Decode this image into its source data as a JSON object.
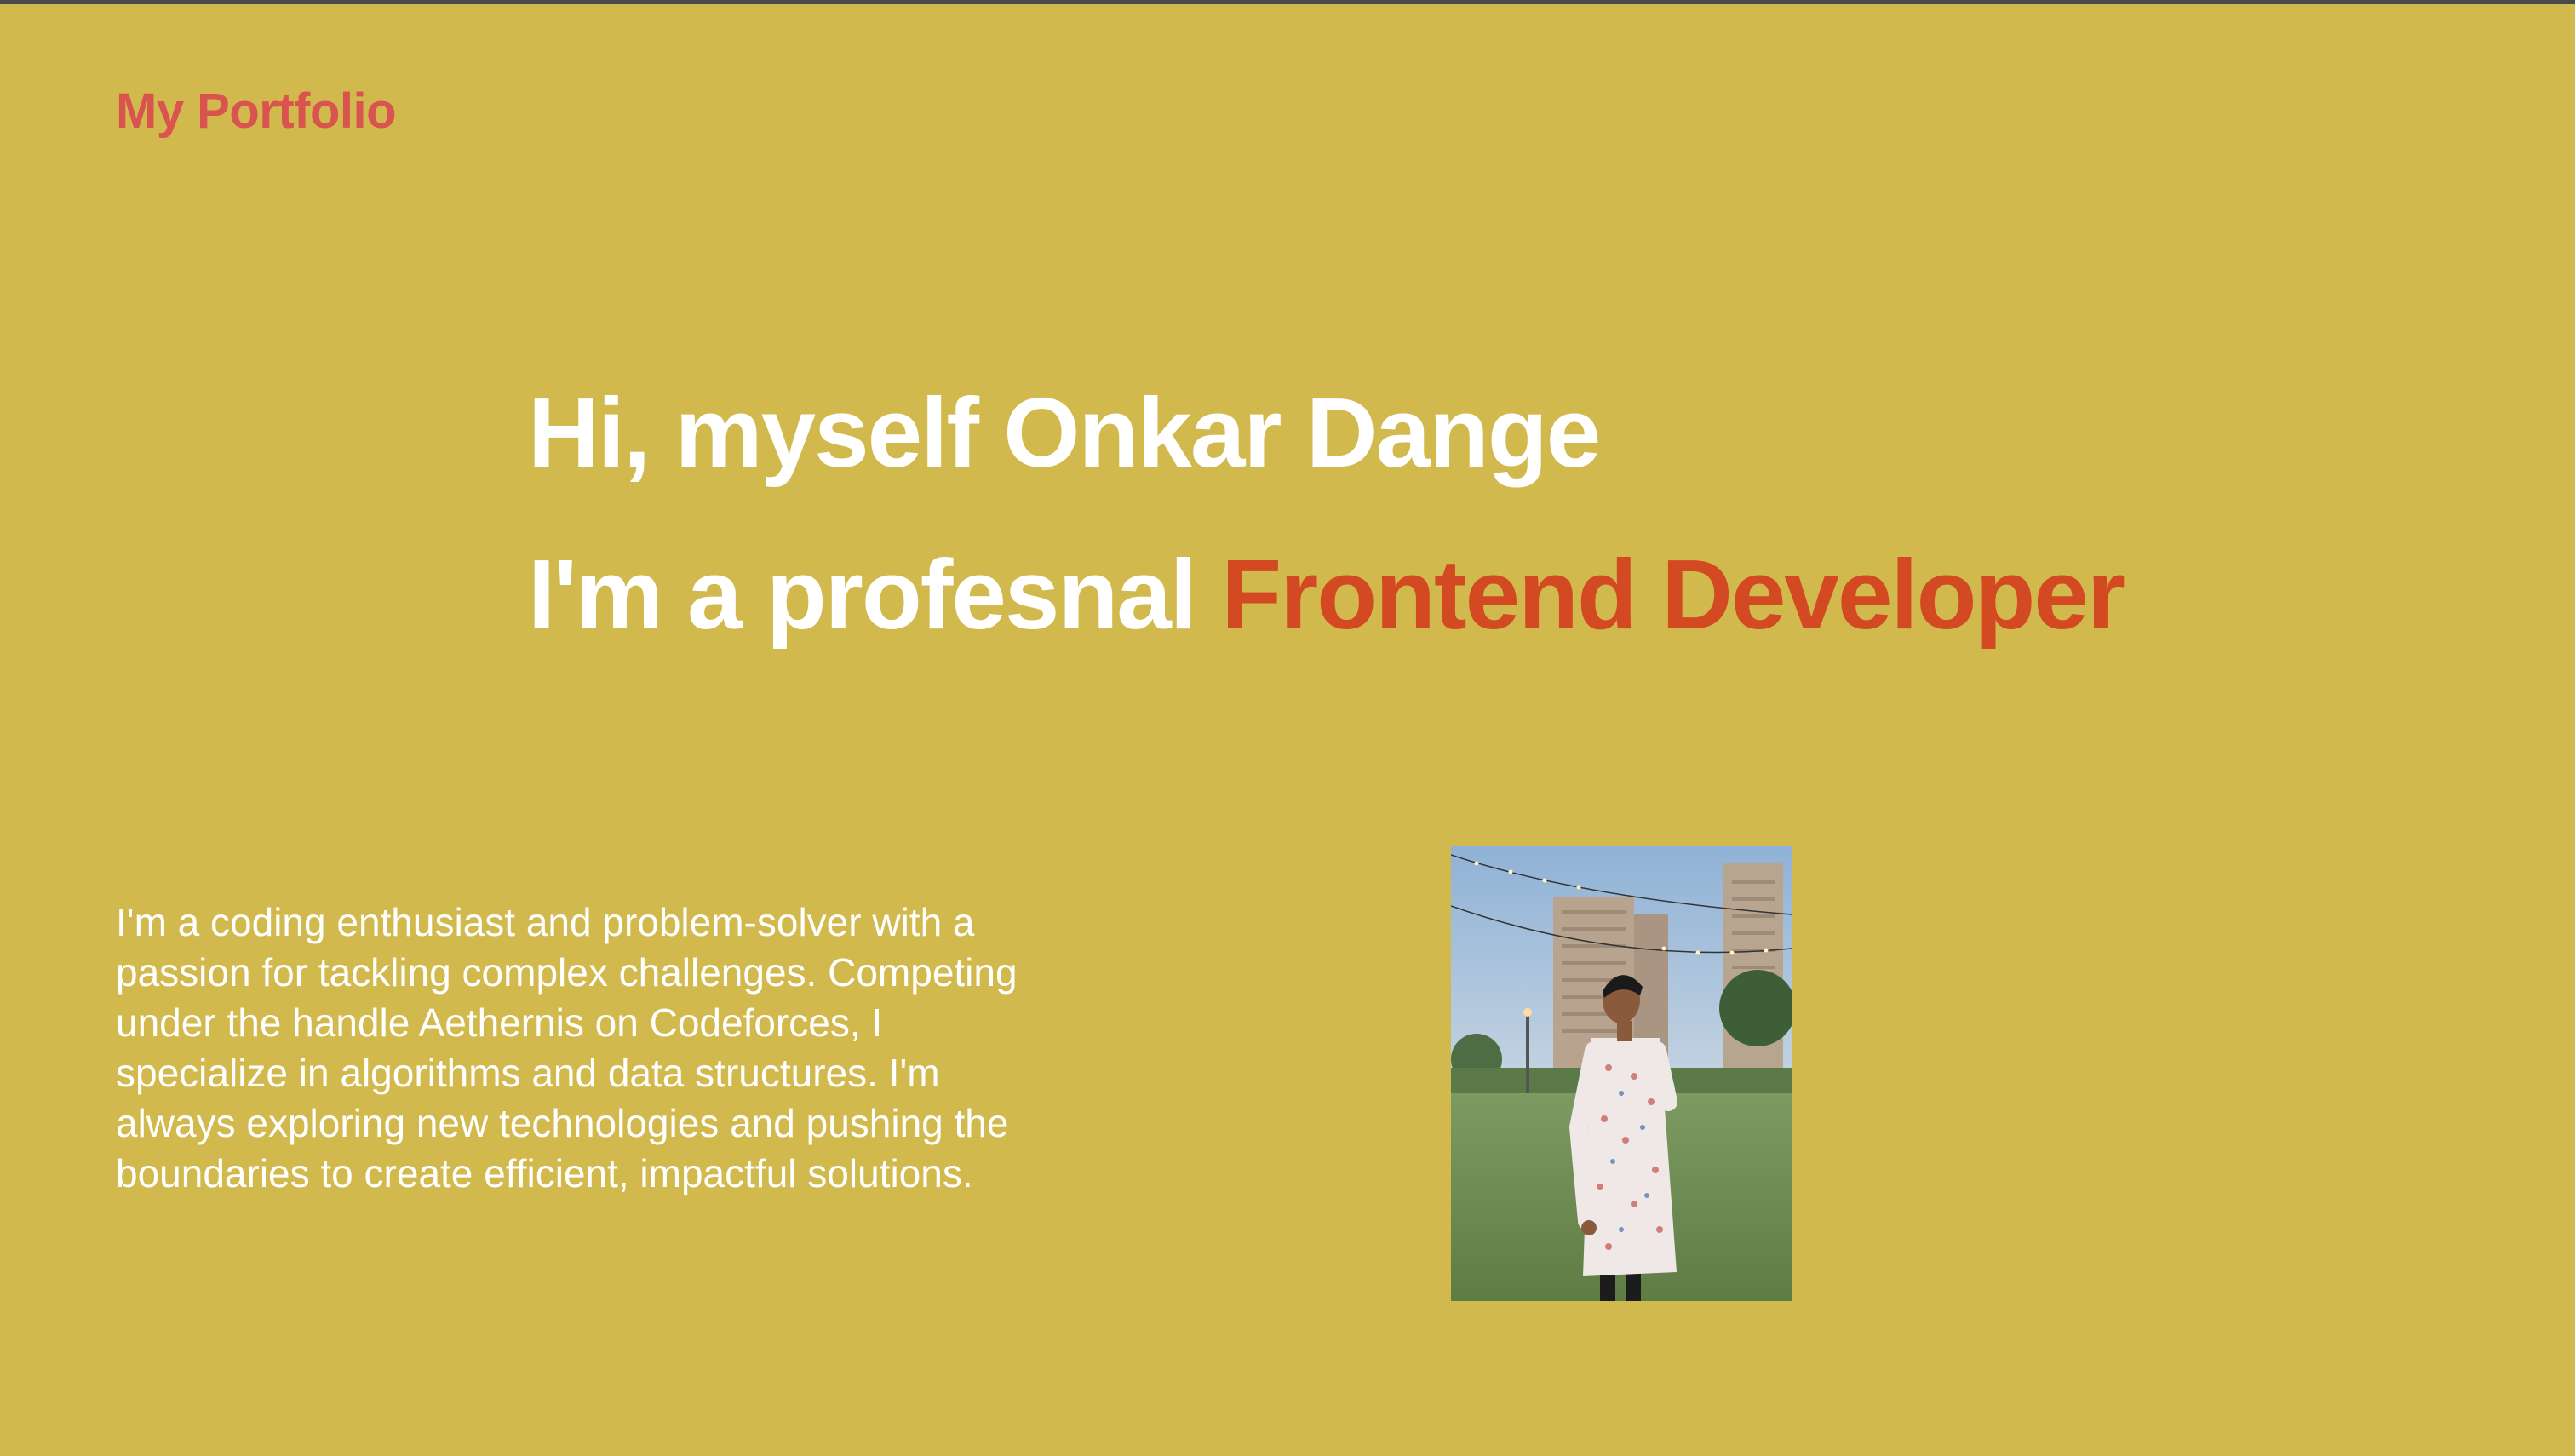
{
  "header": {
    "brand": "My Portfolio"
  },
  "hero": {
    "greeting": "Hi, myself Onkar Dange",
    "role_prefix": "I'm a profesnal ",
    "role_highlight": "Frontend Developer"
  },
  "about": {
    "text": "I'm a coding enthusiast and problem-solver with a passion for tackling complex challenges. Competing under the handle Aethernis on Codeforces, I specialize in algorithms and data structures. I'm always exploring new technologies and pushing the boundaries to create efficient, impactful solutions."
  },
  "colors": {
    "background": "#d2b94e",
    "brand": "#d9534f",
    "highlight": "#d34a22",
    "text": "#ffffff"
  },
  "profile_photo": {
    "description_icon": "profile-photo"
  }
}
